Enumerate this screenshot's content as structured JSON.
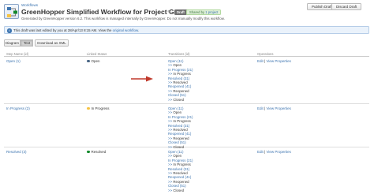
{
  "breadcrumb": "Workflows",
  "title": "GreenHopper Simplified Workflow for Project GOOSE",
  "lozenge": "Draft",
  "shared_badge": {
    "prefix": "Shared by",
    "link": "1 project"
  },
  "generated_text": "Generated by GreenHopper version 6.2. This workflow is managed internally by GreenHopper. Do not manually modify this workflow.",
  "buttons": {
    "publish": "Publish Draft",
    "discard": "Discard Draft"
  },
  "info_message": {
    "icon": "i",
    "text": "This draft was last edited by you at 28/Apr/13 8:15 AM.",
    "link_prefix": "View the",
    "link": "original workflow",
    "link_suffix": "."
  },
  "view_tabs": {
    "diagram": "Diagram",
    "text": "Text",
    "xml": "Download as XML"
  },
  "columns": {
    "step": "Step Name (id)",
    "status": "Linked Status",
    "transitions": "Transitions (id)",
    "operations": "Operations"
  },
  "ops": {
    "edit": "Edit",
    "sep": " | ",
    "view": "View Properties"
  },
  "colors": {
    "accent": "#3b73af",
    "open": "#4a6785",
    "in_progress": "#f6c342",
    "resolved": "#14892c",
    "pointer": "#c0392b"
  },
  "rows": [
    {
      "step": "Open (1)",
      "status": "Open",
      "transitions": [
        {
          "prefix": "",
          "text": "Open (11)"
        },
        {
          "prefix": ">> ",
          "text": "Open"
        },
        {
          "prefix": "",
          "text": "In Progress (21)"
        },
        {
          "prefix": ">> ",
          "text": "In Progress"
        },
        {
          "prefix": "",
          "text": "Resolved (31)"
        },
        {
          "prefix": ">> ",
          "text": "Resolved"
        },
        {
          "prefix": "",
          "text": "Reopened (41)"
        },
        {
          "prefix": ">> ",
          "text": "Reopened"
        },
        {
          "prefix": "",
          "text": "Closed (51)"
        },
        {
          "prefix": ">> ",
          "text": "Closed"
        }
      ]
    },
    {
      "step": "In Progress (2)",
      "status": "In Progress",
      "transitions": [
        {
          "prefix": "",
          "text": "Open (11)"
        },
        {
          "prefix": ">> ",
          "text": "Open"
        },
        {
          "prefix": "",
          "text": "In Progress (21)"
        },
        {
          "prefix": ">> ",
          "text": "In Progress"
        },
        {
          "prefix": "",
          "text": "Resolved (31)"
        },
        {
          "prefix": ">> ",
          "text": "Resolved"
        },
        {
          "prefix": "",
          "text": "Reopened (41)"
        },
        {
          "prefix": ">> ",
          "text": "Reopened"
        },
        {
          "prefix": "",
          "text": "Closed (51)"
        },
        {
          "prefix": ">> ",
          "text": "Closed"
        }
      ]
    },
    {
      "step": "Resolved (3)",
      "status": "Resolved",
      "transitions": [
        {
          "prefix": "",
          "text": "Open (11)"
        },
        {
          "prefix": ">> ",
          "text": "Open"
        },
        {
          "prefix": "",
          "text": "In Progress (21)"
        },
        {
          "prefix": ">> ",
          "text": "In Progress"
        },
        {
          "prefix": "",
          "text": "Resolved (31)"
        },
        {
          "prefix": ">> ",
          "text": "Resolved"
        },
        {
          "prefix": "",
          "text": "Reopened (41)"
        },
        {
          "prefix": ">> ",
          "text": "Reopened"
        },
        {
          "prefix": "",
          "text": "Closed (51)"
        },
        {
          "prefix": ">> ",
          "text": "Closed"
        }
      ]
    }
  ]
}
